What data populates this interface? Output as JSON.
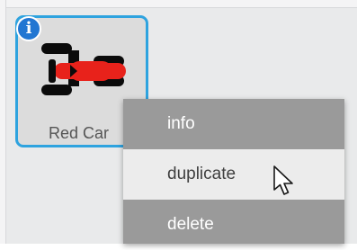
{
  "sprite": {
    "name": "Red Car",
    "icon": "red-car-icon",
    "info_glyph": "i",
    "info_icon": "info-icon",
    "selected_border_color": "#2ea3df",
    "car_color": "#e8221b",
    "wheel_color": "#0b0b0b"
  },
  "context_menu": {
    "items": [
      {
        "label": "info"
      },
      {
        "label": "duplicate"
      },
      {
        "label": "delete"
      }
    ],
    "hover_index": 1
  },
  "pointer": {
    "icon": "mouse-pointer-icon"
  }
}
